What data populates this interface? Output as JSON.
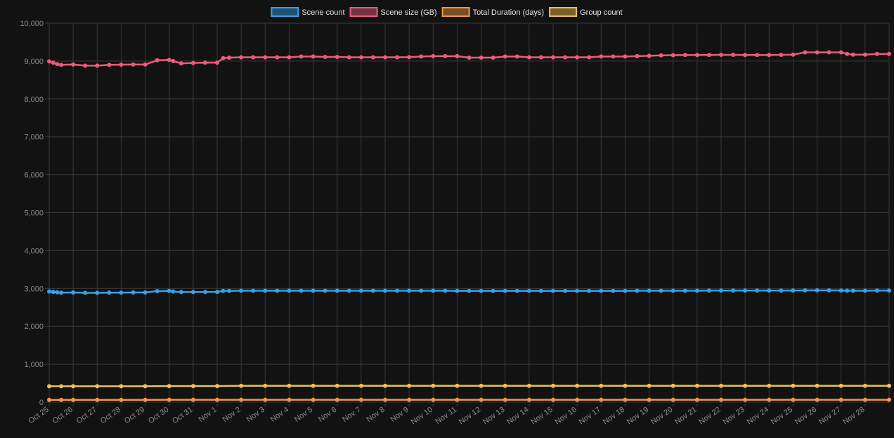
{
  "chart_data": {
    "type": "line",
    "title": "",
    "xlabel": "",
    "ylabel": "",
    "ylim": [
      0,
      10000
    ],
    "yticks": [
      0,
      1000,
      2000,
      3000,
      4000,
      5000,
      6000,
      7000,
      8000,
      9000,
      10000
    ],
    "ytick_labels": [
      "0",
      "1,000",
      "2,000",
      "3,000",
      "4,000",
      "5,000",
      "6,000",
      "7,000",
      "8,000",
      "9,000",
      "10,000"
    ],
    "grid": true,
    "legend_position": "top-center",
    "x_tick_labels": [
      "Oct 25",
      "Oct 26",
      "Oct 27",
      "Oct 28",
      "Oct 29",
      "Oct 30",
      "Oct 31",
      "Nov 1",
      "Nov 2",
      "Nov 3",
      "Nov 4",
      "Nov 5",
      "Nov 6",
      "Nov 7",
      "Nov 8",
      "Nov 9",
      "Nov 10",
      "Nov 11",
      "Nov 12",
      "Nov 13",
      "Nov 14",
      "Nov 15",
      "Nov 16",
      "Nov 17",
      "Nov 18",
      "Nov 19",
      "Nov 20",
      "Nov 21",
      "Nov 22",
      "Nov 23",
      "Nov 24",
      "Nov 25",
      "Nov 26",
      "Nov 27",
      "Nov 28"
    ],
    "x_range": [
      "2023-10-25T00:00",
      "2023-11-29T00:00"
    ],
    "series": [
      {
        "name": "Scene count",
        "color": "#36a2eb",
        "points": [
          [
            "2023-10-25T00:00",
            2920
          ],
          [
            "2023-10-25T04:00",
            2910
          ],
          [
            "2023-10-25T08:00",
            2900
          ],
          [
            "2023-10-25T12:00",
            2890
          ],
          [
            "2023-10-26T00:00",
            2895
          ],
          [
            "2023-10-26T12:00",
            2885
          ],
          [
            "2023-10-27T00:00",
            2885
          ],
          [
            "2023-10-27T12:00",
            2890
          ],
          [
            "2023-10-28T00:00",
            2890
          ],
          [
            "2023-10-28T12:00",
            2895
          ],
          [
            "2023-10-29T00:00",
            2895
          ],
          [
            "2023-10-29T12:00",
            2930
          ],
          [
            "2023-10-30T00:00",
            2935
          ],
          [
            "2023-10-30T04:00",
            2920
          ],
          [
            "2023-10-30T12:00",
            2905
          ],
          [
            "2023-10-31T00:00",
            2905
          ],
          [
            "2023-10-31T12:00",
            2910
          ],
          [
            "2023-11-01T00:00",
            2910
          ],
          [
            "2023-11-01T06:00",
            2935
          ],
          [
            "2023-11-01T12:00",
            2935
          ],
          [
            "2023-11-02T00:00",
            2940
          ],
          [
            "2023-11-02T12:00",
            2940
          ],
          [
            "2023-11-03T00:00",
            2940
          ],
          [
            "2023-11-03T12:00",
            2940
          ],
          [
            "2023-11-04T00:00",
            2940
          ],
          [
            "2023-11-04T12:00",
            2940
          ],
          [
            "2023-11-05T00:00",
            2940
          ],
          [
            "2023-11-05T12:00",
            2940
          ],
          [
            "2023-11-06T00:00",
            2940
          ],
          [
            "2023-11-06T12:00",
            2940
          ],
          [
            "2023-11-07T00:00",
            2940
          ],
          [
            "2023-11-07T12:00",
            2940
          ],
          [
            "2023-11-08T00:00",
            2940
          ],
          [
            "2023-11-08T12:00",
            2940
          ],
          [
            "2023-11-09T00:00",
            2940
          ],
          [
            "2023-11-09T12:00",
            2940
          ],
          [
            "2023-11-10T00:00",
            2940
          ],
          [
            "2023-11-10T12:00",
            2940
          ],
          [
            "2023-11-11T00:00",
            2935
          ],
          [
            "2023-11-11T12:00",
            2935
          ],
          [
            "2023-11-12T00:00",
            2935
          ],
          [
            "2023-11-12T12:00",
            2935
          ],
          [
            "2023-11-13T00:00",
            2935
          ],
          [
            "2023-11-13T12:00",
            2935
          ],
          [
            "2023-11-14T00:00",
            2935
          ],
          [
            "2023-11-14T12:00",
            2935
          ],
          [
            "2023-11-15T00:00",
            2935
          ],
          [
            "2023-11-15T12:00",
            2935
          ],
          [
            "2023-11-16T00:00",
            2935
          ],
          [
            "2023-11-16T12:00",
            2935
          ],
          [
            "2023-11-17T00:00",
            2935
          ],
          [
            "2023-11-17T12:00",
            2935
          ],
          [
            "2023-11-18T00:00",
            2935
          ],
          [
            "2023-11-18T12:00",
            2940
          ],
          [
            "2023-11-19T00:00",
            2940
          ],
          [
            "2023-11-19T12:00",
            2940
          ],
          [
            "2023-11-20T00:00",
            2940
          ],
          [
            "2023-11-20T12:00",
            2940
          ],
          [
            "2023-11-21T00:00",
            2940
          ],
          [
            "2023-11-21T12:00",
            2945
          ],
          [
            "2023-11-22T00:00",
            2945
          ],
          [
            "2023-11-22T12:00",
            2945
          ],
          [
            "2023-11-23T00:00",
            2945
          ],
          [
            "2023-11-23T12:00",
            2945
          ],
          [
            "2023-11-24T00:00",
            2945
          ],
          [
            "2023-11-24T12:00",
            2945
          ],
          [
            "2023-11-25T00:00",
            2945
          ],
          [
            "2023-11-25T12:00",
            2950
          ],
          [
            "2023-11-26T00:00",
            2950
          ],
          [
            "2023-11-26T12:00",
            2950
          ],
          [
            "2023-11-27T00:00",
            2945
          ],
          [
            "2023-11-27T06:00",
            2940
          ],
          [
            "2023-11-27T12:00",
            2940
          ],
          [
            "2023-11-28T00:00",
            2940
          ],
          [
            "2023-11-28T12:00",
            2945
          ],
          [
            "2023-11-29T00:00",
            2945
          ]
        ]
      },
      {
        "name": "Scene size (GB)",
        "color": "#ef5a7e",
        "points": [
          [
            "2023-10-25T00:00",
            8990
          ],
          [
            "2023-10-25T04:00",
            8960
          ],
          [
            "2023-10-25T08:00",
            8920
          ],
          [
            "2023-10-25T12:00",
            8900
          ],
          [
            "2023-10-26T00:00",
            8910
          ],
          [
            "2023-10-26T12:00",
            8880
          ],
          [
            "2023-10-27T00:00",
            8880
          ],
          [
            "2023-10-27T12:00",
            8900
          ],
          [
            "2023-10-28T00:00",
            8905
          ],
          [
            "2023-10-28T12:00",
            8910
          ],
          [
            "2023-10-29T00:00",
            8910
          ],
          [
            "2023-10-29T12:00",
            9020
          ],
          [
            "2023-10-30T00:00",
            9030
          ],
          [
            "2023-10-30T04:00",
            9000
          ],
          [
            "2023-10-30T12:00",
            8940
          ],
          [
            "2023-10-31T00:00",
            8950
          ],
          [
            "2023-10-31T12:00",
            8960
          ],
          [
            "2023-11-01T00:00",
            8960
          ],
          [
            "2023-11-01T06:00",
            9080
          ],
          [
            "2023-11-01T12:00",
            9090
          ],
          [
            "2023-11-02T00:00",
            9100
          ],
          [
            "2023-11-02T12:00",
            9100
          ],
          [
            "2023-11-03T00:00",
            9100
          ],
          [
            "2023-11-03T12:00",
            9100
          ],
          [
            "2023-11-04T00:00",
            9100
          ],
          [
            "2023-11-04T12:00",
            9120
          ],
          [
            "2023-11-05T00:00",
            9120
          ],
          [
            "2023-11-05T12:00",
            9110
          ],
          [
            "2023-11-06T00:00",
            9110
          ],
          [
            "2023-11-06T12:00",
            9100
          ],
          [
            "2023-11-07T00:00",
            9100
          ],
          [
            "2023-11-07T12:00",
            9100
          ],
          [
            "2023-11-08T00:00",
            9100
          ],
          [
            "2023-11-08T12:00",
            9100
          ],
          [
            "2023-11-09T00:00",
            9105
          ],
          [
            "2023-11-09T12:00",
            9120
          ],
          [
            "2023-11-10T00:00",
            9130
          ],
          [
            "2023-11-10T12:00",
            9130
          ],
          [
            "2023-11-11T00:00",
            9130
          ],
          [
            "2023-11-11T12:00",
            9090
          ],
          [
            "2023-11-12T00:00",
            9090
          ],
          [
            "2023-11-12T12:00",
            9090
          ],
          [
            "2023-11-13T00:00",
            9120
          ],
          [
            "2023-11-13T12:00",
            9120
          ],
          [
            "2023-11-14T00:00",
            9100
          ],
          [
            "2023-11-14T12:00",
            9100
          ],
          [
            "2023-11-15T00:00",
            9100
          ],
          [
            "2023-11-15T12:00",
            9100
          ],
          [
            "2023-11-16T00:00",
            9100
          ],
          [
            "2023-11-16T12:00",
            9100
          ],
          [
            "2023-11-17T00:00",
            9120
          ],
          [
            "2023-11-17T12:00",
            9120
          ],
          [
            "2023-11-18T00:00",
            9120
          ],
          [
            "2023-11-18T12:00",
            9130
          ],
          [
            "2023-11-19T00:00",
            9140
          ],
          [
            "2023-11-19T12:00",
            9150
          ],
          [
            "2023-11-20T00:00",
            9155
          ],
          [
            "2023-11-20T12:00",
            9160
          ],
          [
            "2023-11-21T00:00",
            9160
          ],
          [
            "2023-11-21T12:00",
            9160
          ],
          [
            "2023-11-22T00:00",
            9165
          ],
          [
            "2023-11-22T12:00",
            9165
          ],
          [
            "2023-11-23T00:00",
            9160
          ],
          [
            "2023-11-23T12:00",
            9160
          ],
          [
            "2023-11-24T00:00",
            9160
          ],
          [
            "2023-11-24T12:00",
            9165
          ],
          [
            "2023-11-25T00:00",
            9170
          ],
          [
            "2023-11-25T12:00",
            9230
          ],
          [
            "2023-11-26T00:00",
            9230
          ],
          [
            "2023-11-26T12:00",
            9230
          ],
          [
            "2023-11-27T00:00",
            9230
          ],
          [
            "2023-11-27T06:00",
            9190
          ],
          [
            "2023-11-27T12:00",
            9170
          ],
          [
            "2023-11-28T00:00",
            9170
          ],
          [
            "2023-11-28T12:00",
            9190
          ],
          [
            "2023-11-29T00:00",
            9190
          ]
        ]
      },
      {
        "name": "Total Duration (days)",
        "color": "#f39a3c",
        "points": [
          [
            "2023-10-25T00:00",
            62
          ],
          [
            "2023-10-25T12:00",
            62
          ],
          [
            "2023-10-26T00:00",
            62
          ],
          [
            "2023-10-27T00:00",
            62
          ],
          [
            "2023-10-28T00:00",
            62
          ],
          [
            "2023-10-29T00:00",
            62
          ],
          [
            "2023-10-30T00:00",
            63
          ],
          [
            "2023-10-31T00:00",
            63
          ],
          [
            "2023-11-01T00:00",
            63
          ],
          [
            "2023-11-02T00:00",
            63
          ],
          [
            "2023-11-03T00:00",
            63
          ],
          [
            "2023-11-04T00:00",
            63
          ],
          [
            "2023-11-05T00:00",
            63
          ],
          [
            "2023-11-06T00:00",
            63
          ],
          [
            "2023-11-07T00:00",
            63
          ],
          [
            "2023-11-08T00:00",
            63
          ],
          [
            "2023-11-09T00:00",
            63
          ],
          [
            "2023-11-10T00:00",
            63
          ],
          [
            "2023-11-11T00:00",
            63
          ],
          [
            "2023-11-12T00:00",
            63
          ],
          [
            "2023-11-13T00:00",
            63
          ],
          [
            "2023-11-14T00:00",
            63
          ],
          [
            "2023-11-15T00:00",
            63
          ],
          [
            "2023-11-16T00:00",
            63
          ],
          [
            "2023-11-17T00:00",
            63
          ],
          [
            "2023-11-18T00:00",
            63
          ],
          [
            "2023-11-19T00:00",
            63
          ],
          [
            "2023-11-20T00:00",
            63
          ],
          [
            "2023-11-21T00:00",
            63
          ],
          [
            "2023-11-22T00:00",
            63
          ],
          [
            "2023-11-23T00:00",
            63
          ],
          [
            "2023-11-24T00:00",
            63
          ],
          [
            "2023-11-25T00:00",
            63
          ],
          [
            "2023-11-26T00:00",
            63
          ],
          [
            "2023-11-27T00:00",
            63
          ],
          [
            "2023-11-28T00:00",
            63
          ],
          [
            "2023-11-29T00:00",
            63
          ]
        ]
      },
      {
        "name": "Group count",
        "color": "#f2c14e",
        "points": [
          [
            "2023-10-25T00:00",
            420
          ],
          [
            "2023-10-25T12:00",
            420
          ],
          [
            "2023-10-26T00:00",
            420
          ],
          [
            "2023-10-27T00:00",
            420
          ],
          [
            "2023-10-28T00:00",
            420
          ],
          [
            "2023-10-29T00:00",
            420
          ],
          [
            "2023-10-30T00:00",
            425
          ],
          [
            "2023-10-31T00:00",
            425
          ],
          [
            "2023-11-01T00:00",
            425
          ],
          [
            "2023-11-02T00:00",
            430
          ],
          [
            "2023-11-03T00:00",
            430
          ],
          [
            "2023-11-04T00:00",
            430
          ],
          [
            "2023-11-05T00:00",
            430
          ],
          [
            "2023-11-06T00:00",
            430
          ],
          [
            "2023-11-07T00:00",
            430
          ],
          [
            "2023-11-08T00:00",
            430
          ],
          [
            "2023-11-09T00:00",
            430
          ],
          [
            "2023-11-10T00:00",
            430
          ],
          [
            "2023-11-11T00:00",
            430
          ],
          [
            "2023-11-12T00:00",
            430
          ],
          [
            "2023-11-13T00:00",
            430
          ],
          [
            "2023-11-14T00:00",
            430
          ],
          [
            "2023-11-15T00:00",
            430
          ],
          [
            "2023-11-16T00:00",
            430
          ],
          [
            "2023-11-17T00:00",
            430
          ],
          [
            "2023-11-18T00:00",
            430
          ],
          [
            "2023-11-19T00:00",
            430
          ],
          [
            "2023-11-20T00:00",
            430
          ],
          [
            "2023-11-21T00:00",
            430
          ],
          [
            "2023-11-22T00:00",
            430
          ],
          [
            "2023-11-23T00:00",
            430
          ],
          [
            "2023-11-24T00:00",
            430
          ],
          [
            "2023-11-25T00:00",
            430
          ],
          [
            "2023-11-26T00:00",
            430
          ],
          [
            "2023-11-27T00:00",
            430
          ],
          [
            "2023-11-28T00:00",
            430
          ],
          [
            "2023-11-29T00:00",
            430
          ]
        ]
      }
    ]
  }
}
